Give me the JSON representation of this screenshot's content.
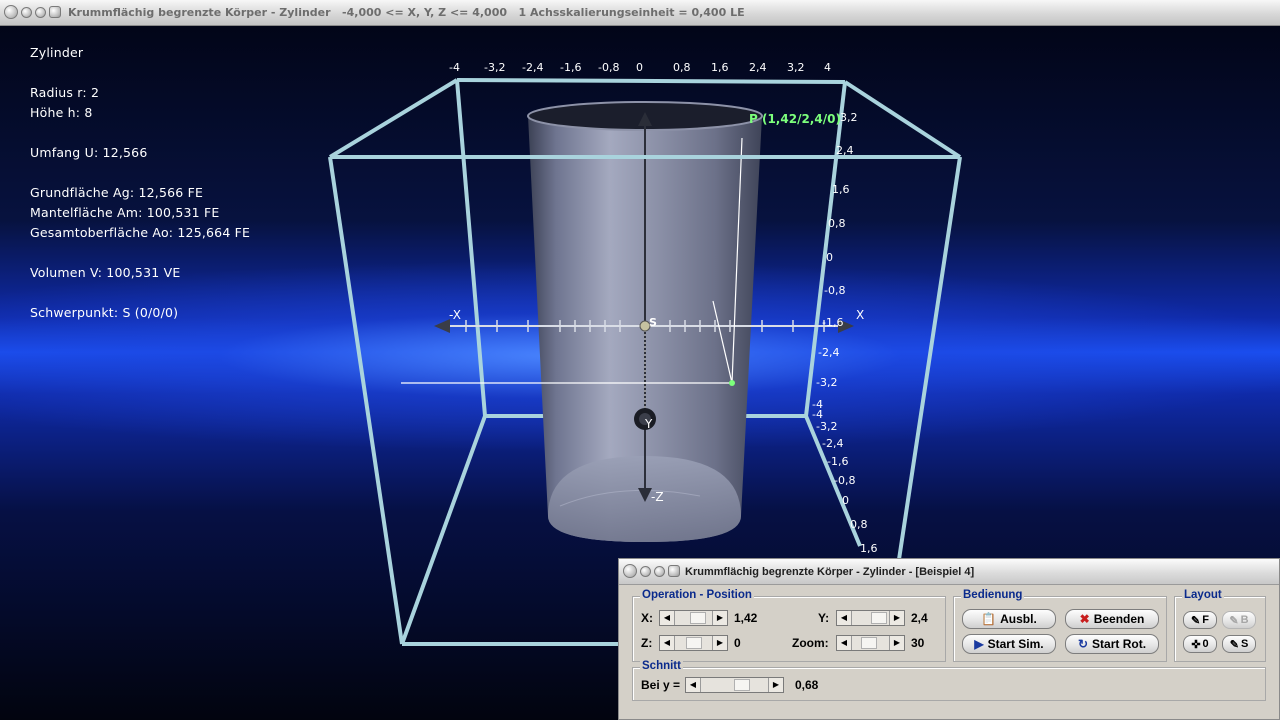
{
  "window": {
    "title": "Krummflächig begrenzte Körper - Zylinder   -4,000 <= X, Y, Z <= 4,000   1 Achsskalierungseinheit = 0,400 LE"
  },
  "info": {
    "heading": "Zylinder",
    "radius": "Radius r: 2",
    "hoehe": "Höhe h: 8",
    "umfang": "Umfang U: 12,566",
    "grundflaeche": "Grundfläche Ag: 12,566 FE",
    "mantelflaeche": "Mantelfläche Am: 100,531 FE",
    "gesamtoberflaeche": "Gesamtoberfläche Ao: 125,664 FE",
    "volumen": "Volumen V: 100,531 VE",
    "schwerpunkt": "Schwerpunkt: S (0/0/0)"
  },
  "scene": {
    "point_label": "P (1,42/2,4/0)",
    "center_label": "S",
    "axis_labels": {
      "x_pos": "X",
      "x_neg": "-X",
      "y": "Y",
      "z_neg": "-Z"
    },
    "top_ticks": [
      "-4",
      "-3,2",
      "-2,4",
      "-1,6",
      "-0,8",
      "0",
      "0,8",
      "1,6",
      "2,4",
      "3,2",
      "4"
    ],
    "right_ticks_upper": [
      "3,2",
      "2,4",
      "1,6",
      "0,8",
      "0",
      "-0,8",
      "-1,6",
      "-2,4",
      "-3,2",
      "-4"
    ],
    "right_ticks_lower": [
      "-4",
      "-3,2",
      "-2,4",
      "-1,6",
      "-0,8",
      "0",
      "0,8",
      "1,6"
    ],
    "colors": {
      "frame": "#a9d3dd",
      "point": "#7cff7c",
      "cylinder": "#8a8fa6"
    }
  },
  "panel": {
    "title": "Krummflächig begrenzte Körper - Zylinder - [Beispiel 4]",
    "operation": {
      "legend": "Operation - Position",
      "x_label": "X:",
      "x_value": "1,42",
      "y_label": "Y:",
      "y_value": "2,4",
      "z_label": "Z:",
      "z_value": "0",
      "zoom_label": "Zoom:",
      "zoom_value": "30"
    },
    "bedienung": {
      "legend": "Bedienung",
      "ausbl": "Ausbl.",
      "beenden": "Beenden",
      "start_sim": "Start Sim.",
      "start_rot": "Start Rot."
    },
    "layout": {
      "legend": "Layout",
      "f": "F",
      "b": "B",
      "o": "0",
      "s": "S"
    },
    "schnitt": {
      "legend": "Schnitt",
      "label": "Bei y =",
      "value": "0,68"
    }
  }
}
